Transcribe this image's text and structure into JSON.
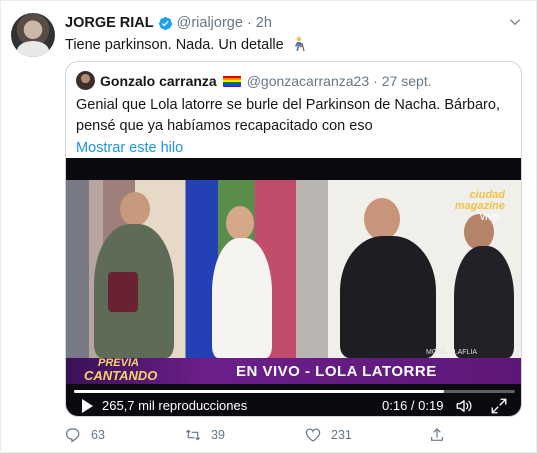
{
  "tweet": {
    "name": "JORGE RIAL",
    "handle": "@rialjorge",
    "separator": "·",
    "time": "2h",
    "text": "Tiene parkinson. Nada. Un detalle"
  },
  "quote": {
    "name": "Gonzalo carranza",
    "handle": "@gonzacarranza23",
    "separator": "·",
    "time": "27 sept.",
    "text": "Genial que Lola latorre se burle del Parkinson de Nacha. Bárbaro, pensé que ya habíamos recapacitado con eso",
    "show_thread": "Mostrar este hilo"
  },
  "video": {
    "overlay_banner": "EN VIVO - LOLA LATORRE",
    "channel_logo": [
      "ciudad",
      "magazine"
    ],
    "channel_sub": "VIVO",
    "location": "MOVIL · LAFLIA",
    "show_logo": [
      "PREVIA",
      "CANTANDO"
    ],
    "views": "265,7 mil reproducciones",
    "time_display": "0:16 / 0:19",
    "progress_fraction": 0.84
  },
  "actions": {
    "replies": "63",
    "retweets": "39",
    "likes": "231"
  },
  "colors": {
    "link": "#1b95e0",
    "muted": "#657786",
    "verified": "#1da1f2"
  }
}
